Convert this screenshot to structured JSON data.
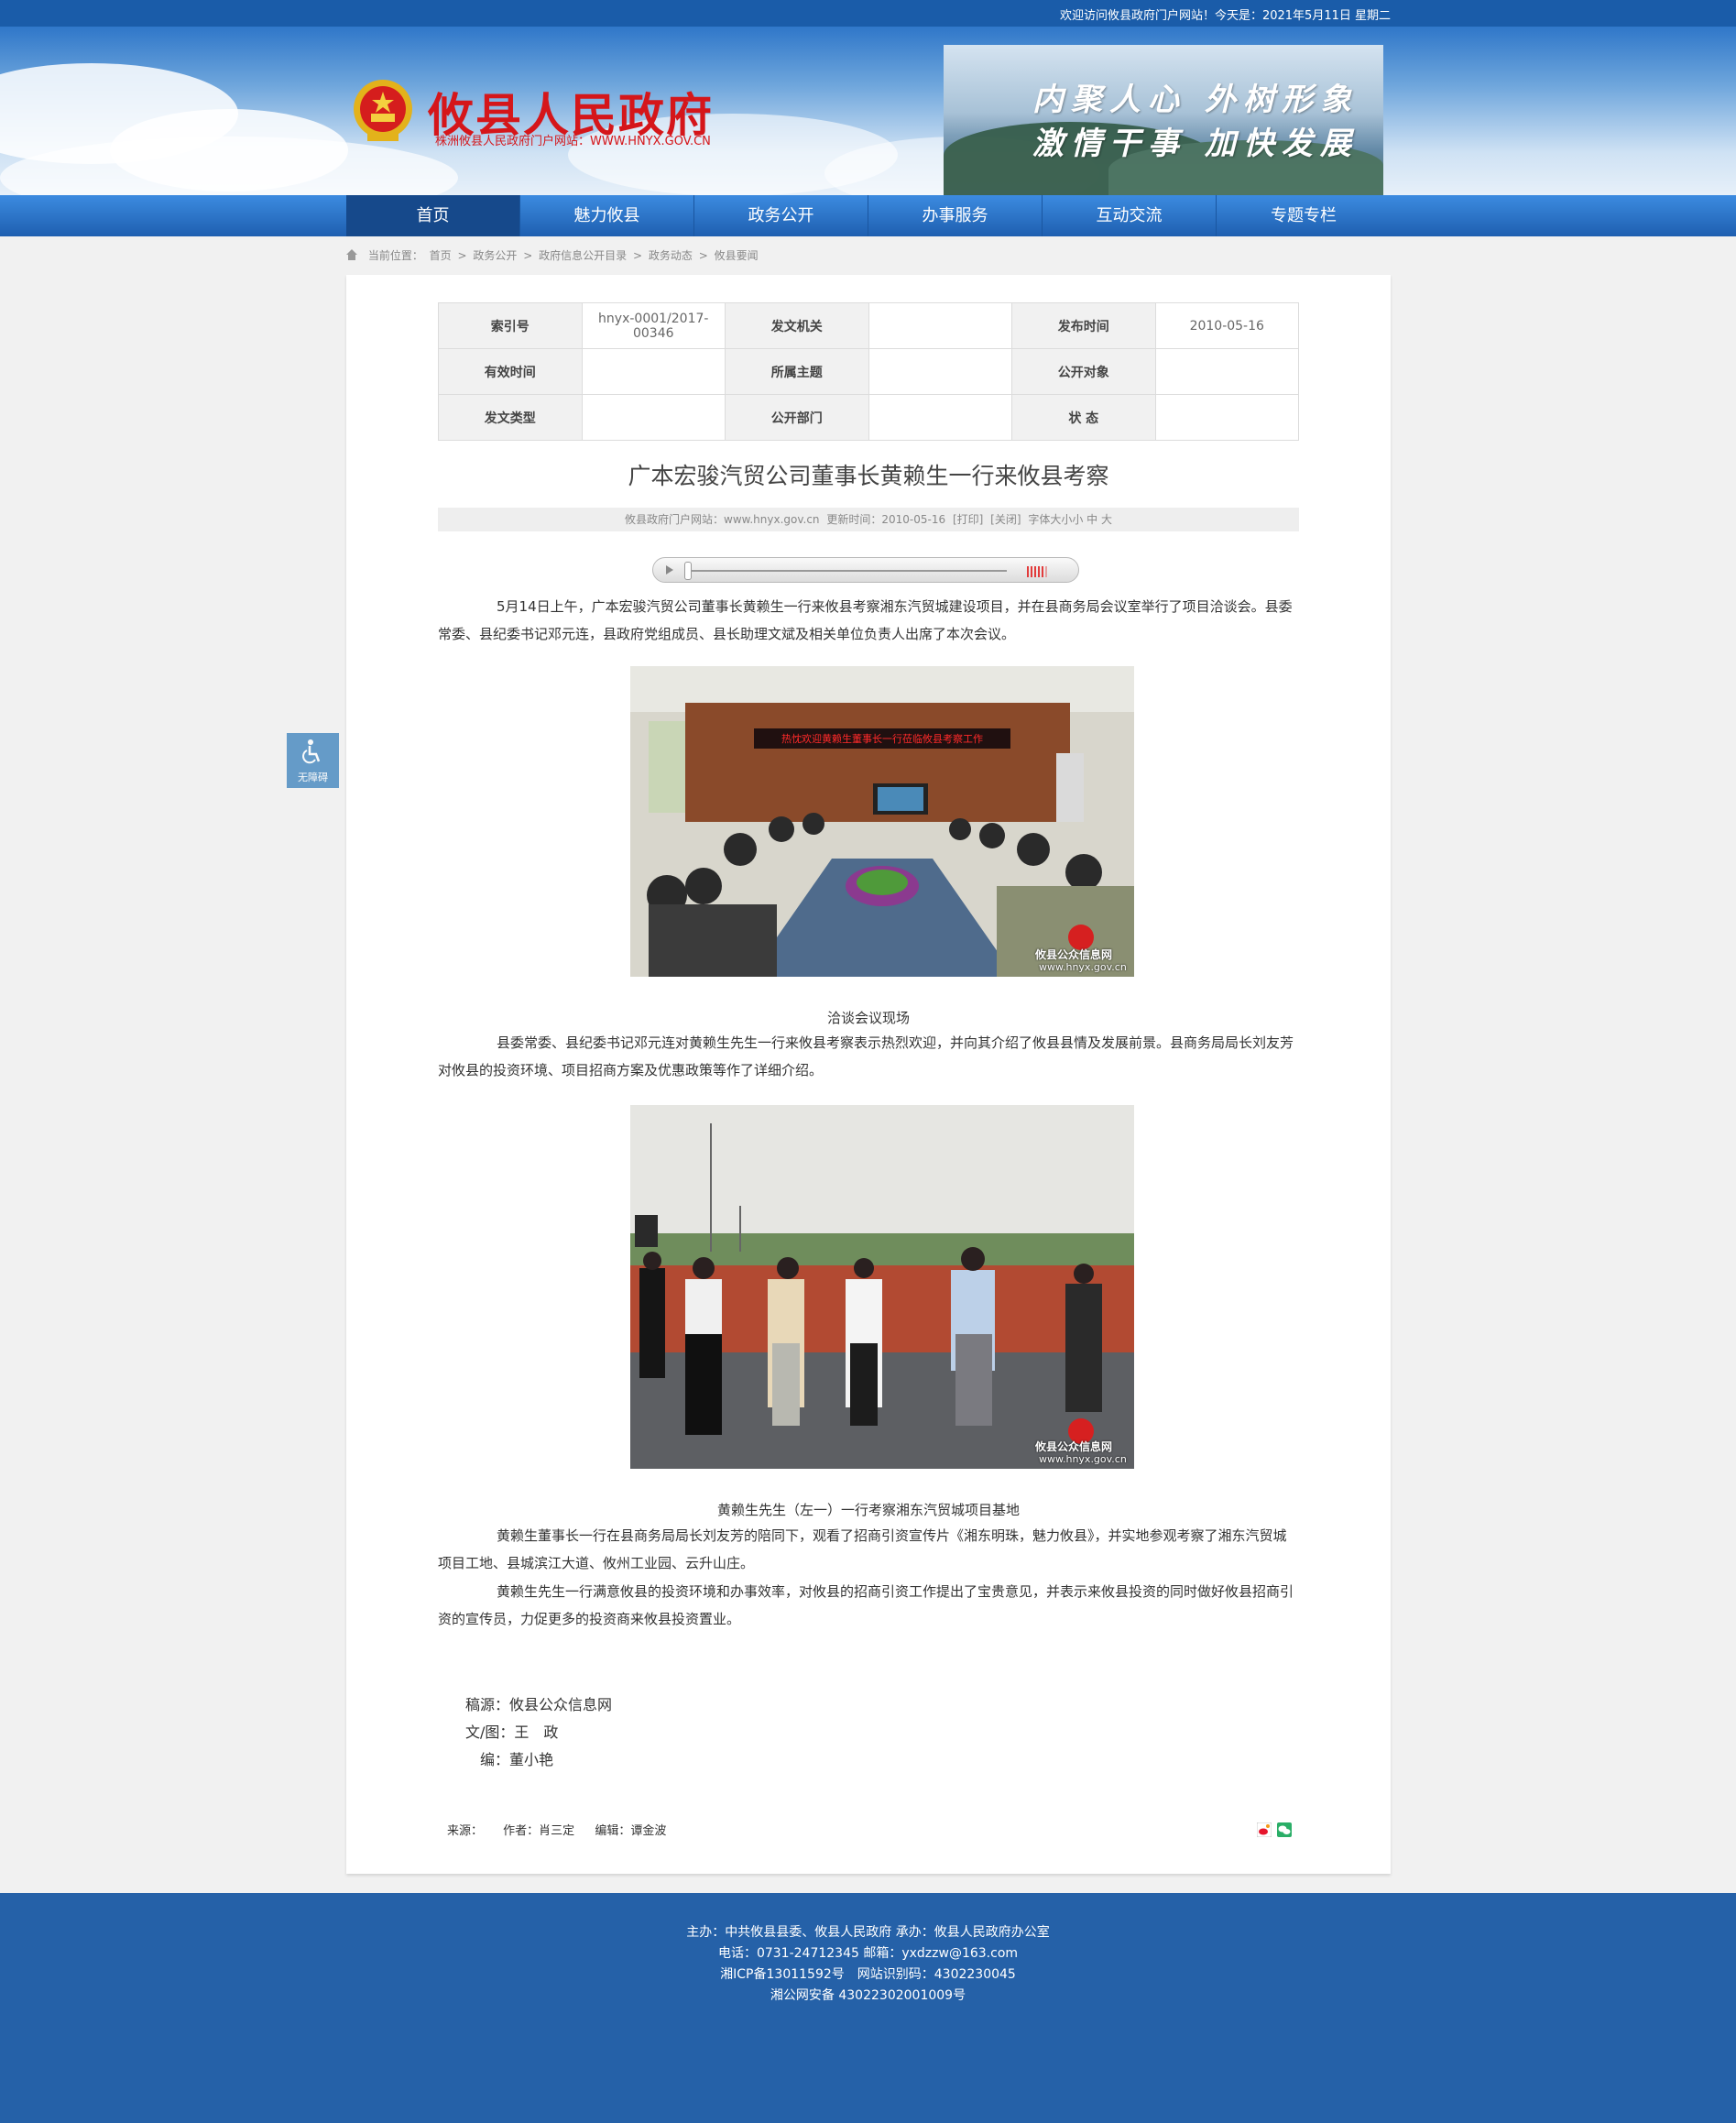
{
  "topbar": {
    "welcome": "欢迎访问攸县政府门户网站！今天是：2021年5月11日 星期二"
  },
  "header": {
    "site_title": "攸县人民政府",
    "site_subtitle": "株洲攸县人民政府门户网站：WWW.HNYX.GOV.CN",
    "slogan_line1": "内聚人心 外树形象",
    "slogan_line2": "激情干事 加快发展"
  },
  "nav": {
    "items": [
      {
        "label": "首页"
      },
      {
        "label": "魅力攸县"
      },
      {
        "label": "政务公开"
      },
      {
        "label": "办事服务"
      },
      {
        "label": "互动交流"
      },
      {
        "label": "专题专栏"
      }
    ]
  },
  "breadcrumb": {
    "prefix": "当前位置：",
    "items": [
      "首页",
      "政务公开",
      "政府信息公开目录",
      "政务动态",
      "攸县要闻"
    ],
    "separator": ">"
  },
  "meta": {
    "rows": [
      [
        {
          "k": "索引号"
        },
        {
          "v": "hnyx-0001/2017-00346"
        },
        {
          "k": "发文机关"
        },
        {
          "v": ""
        },
        {
          "k": "发布时间"
        },
        {
          "v": "2010-05-16"
        }
      ],
      [
        {
          "k": "有效时间"
        },
        {
          "v": ""
        },
        {
          "k": "所属主题"
        },
        {
          "v": ""
        },
        {
          "k": "公开对象"
        },
        {
          "v": ""
        }
      ],
      [
        {
          "k": "发文类型"
        },
        {
          "v": ""
        },
        {
          "k": "公开部门"
        },
        {
          "v": ""
        },
        {
          "k": "状 态"
        },
        {
          "v": ""
        }
      ]
    ]
  },
  "article": {
    "title": "广本宏骏汽贸公司董事长黄赖生一行来攸县考察",
    "source_label": "攸县政府门户网站：www.hnyx.gov.cn",
    "updated_label": "更新时间：2010-05-16",
    "print_label": "[打印]",
    "close_label": "[关闭]",
    "font_label": "字体大小小 中 大",
    "para1": "5月14日上午，广本宏骏汽贸公司董事长黄赖生一行来攸县考察湘东汽贸城建设项目，并在县商务局会议室举行了项目洽谈会。县委常委、县纪委书记邓元连，县政府党组成员、县长助理文斌及相关单位负责人出席了本次会议。",
    "photo1_banner": "热忱欢迎黄赖生董事长一行莅临攸县考察工作",
    "photo1_caption": "洽谈会议现场",
    "para2": "县委常委、县纪委书记邓元连对黄赖生先生一行来攸县考察表示热烈欢迎，并向其介绍了攸县县情及发展前景。县商务局局长刘友芳对攸县的投资环境、项目招商方案及优惠政策等作了详细介绍。",
    "photo2_caption": "黄赖生先生（左一）一行考察湘东汽贸城项目基地",
    "para3": "黄赖生董事长一行在县商务局局长刘友芳的陪同下，观看了招商引资宣传片《湘东明珠，魅力攸县》，并实地参观考察了湘东汽贸城项目工地、县城滨江大道、攸州工业园、云升山庄。",
    "para4": "黄赖生先生一行满意攸县的投资环境和办事效率，对攸县的招商引资工作提出了宝贵意见，并表示来攸县投资的同时做好攸县招商引资的宣传员，力促更多的投资商来攸县投资置业。",
    "watermark_site": "攸县公众信息网",
    "watermark_url": "www.hnyx.gov.cn",
    "credit_source": "稿源：攸县公众信息网",
    "credit_author": "文/图：王　政",
    "credit_editor": "编：董小艳"
  },
  "footline": {
    "source": "来源：",
    "author": "作者：肖三定",
    "editor": "编辑：谭金波"
  },
  "a11y": {
    "label": "无障碍"
  },
  "footer": {
    "line1": "主办：中共攸县县委、攸县人民政府 承办：攸县人民政府办公室",
    "line2": "电话：0731-24712345 邮箱：yxdzzw@163.com",
    "line3": "湘ICP备13011592号　网站识别码：4302230045",
    "line4": "湘公网安备 43022302001009号"
  },
  "colors": {
    "brand_blue": "#1a5ca9",
    "title_red": "#d5161a",
    "footer_blue": "#2561a8"
  }
}
